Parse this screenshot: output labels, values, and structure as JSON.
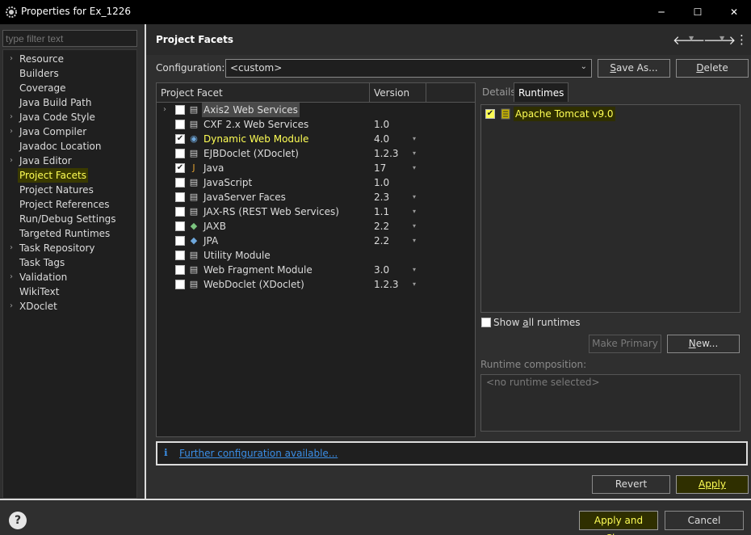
{
  "window": {
    "title": "Properties for Ex_1226",
    "minimize": "─",
    "maximize": "☐",
    "close": "✕"
  },
  "sidebar": {
    "filter_placeholder": "type filter text",
    "items": [
      {
        "label": "Resource",
        "expandable": true
      },
      {
        "label": "Builders",
        "expandable": false
      },
      {
        "label": "Coverage",
        "expandable": false
      },
      {
        "label": "Java Build Path",
        "expandable": false
      },
      {
        "label": "Java Code Style",
        "expandable": true
      },
      {
        "label": "Java Compiler",
        "expandable": true
      },
      {
        "label": "Javadoc Location",
        "expandable": false
      },
      {
        "label": "Java Editor",
        "expandable": true
      },
      {
        "label": "Project Facets",
        "expandable": false,
        "selected": true
      },
      {
        "label": "Project Natures",
        "expandable": false
      },
      {
        "label": "Project References",
        "expandable": false
      },
      {
        "label": "Run/Debug Settings",
        "expandable": false
      },
      {
        "label": "Targeted Runtimes",
        "expandable": false
      },
      {
        "label": "Task Repository",
        "expandable": true
      },
      {
        "label": "Task Tags",
        "expandable": false
      },
      {
        "label": "Validation",
        "expandable": true
      },
      {
        "label": "WikiText",
        "expandable": false
      },
      {
        "label": "XDoclet",
        "expandable": true
      }
    ]
  },
  "header": {
    "title": "Project Facets",
    "back_icon": "🡐",
    "forward_icon": "🡒",
    "menu_icon": "⋮"
  },
  "config": {
    "label": "Configuration:",
    "value": "<custom>",
    "save_as": "Save As...",
    "delete": "Delete"
  },
  "facets": {
    "col_facet": "Project Facet",
    "col_version": "Version",
    "rows": [
      {
        "name": "Axis2 Web Services",
        "version": "",
        "checked": false,
        "expandable": true,
        "has_drop": false,
        "icon": "page-icon",
        "highlight": false,
        "grayed": true
      },
      {
        "name": "CXF 2.x Web Services",
        "version": "1.0",
        "checked": false,
        "has_drop": false,
        "icon": "page-icon"
      },
      {
        "name": "Dynamic Web Module",
        "version": "4.0",
        "checked": true,
        "has_drop": true,
        "icon": "web-module-icon",
        "highlight": true
      },
      {
        "name": "EJBDoclet (XDoclet)",
        "version": "1.2.3",
        "checked": false,
        "has_drop": true,
        "icon": "page-icon"
      },
      {
        "name": "Java",
        "version": "17",
        "checked": true,
        "has_drop": true,
        "icon": "java-icon"
      },
      {
        "name": "JavaScript",
        "version": "1.0",
        "checked": false,
        "has_drop": false,
        "icon": "page-icon"
      },
      {
        "name": "JavaServer Faces",
        "version": "2.3",
        "checked": false,
        "has_drop": true,
        "icon": "page-icon"
      },
      {
        "name": "JAX-RS (REST Web Services)",
        "version": "1.1",
        "checked": false,
        "has_drop": true,
        "icon": "page-icon"
      },
      {
        "name": "JAXB",
        "version": "2.2",
        "checked": false,
        "has_drop": true,
        "icon": "jaxb-icon"
      },
      {
        "name": "JPA",
        "version": "2.2",
        "checked": false,
        "has_drop": true,
        "icon": "jpa-icon"
      },
      {
        "name": "Utility Module",
        "version": "",
        "checked": false,
        "has_drop": false,
        "icon": "page-icon"
      },
      {
        "name": "Web Fragment Module",
        "version": "3.0",
        "checked": false,
        "has_drop": true,
        "icon": "page-icon"
      },
      {
        "name": "WebDoclet (XDoclet)",
        "version": "1.2.3",
        "checked": false,
        "has_drop": true,
        "icon": "page-icon"
      }
    ]
  },
  "right": {
    "tab_details": "Details",
    "tab_runtimes": "Runtimes",
    "runtime_name": "Apache Tomcat v9.0",
    "runtime_checked": true,
    "show_all_prefix": "Show ",
    "show_all_u": "a",
    "show_all_suffix": "ll runtimes",
    "make_primary": "Make Primary",
    "new_u": "N",
    "new_rest": "ew...",
    "composition_label": "Runtime composition:",
    "composition_value": "<no runtime selected>"
  },
  "info": {
    "link": "Further configuration available..."
  },
  "actions": {
    "revert": "Revert",
    "apply": "Apply",
    "apply_close": "Apply and Close",
    "cancel": "Cancel",
    "help": "?"
  },
  "colors": {
    "highlight": "#ffff55",
    "link": "#3a8ee6",
    "background": "#2f2f2f",
    "panel": "#1f1f1f"
  }
}
